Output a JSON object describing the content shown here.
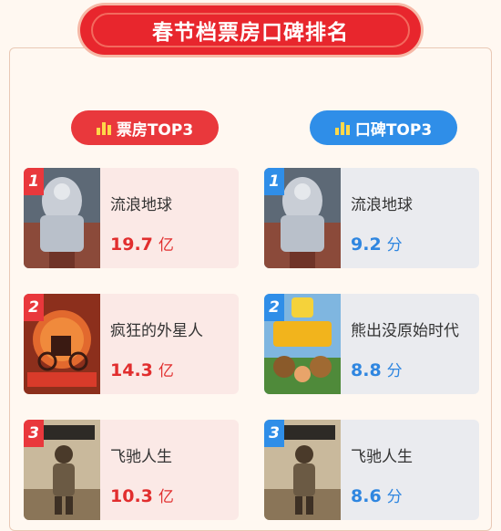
{
  "title": "春节档票房口碑排名",
  "box_office": {
    "label": "票房TOP3",
    "items": [
      {
        "rank": "1",
        "name": "流浪地球",
        "value": "19.7",
        "unit": "亿"
      },
      {
        "rank": "2",
        "name": "疯狂的外星人",
        "value": "14.3",
        "unit": "亿"
      },
      {
        "rank": "3",
        "name": "飞驰人生",
        "value": "10.3",
        "unit": "亿"
      }
    ]
  },
  "reputation": {
    "label": "口碑TOP3",
    "items": [
      {
        "rank": "1",
        "name": "流浪地球",
        "value": "9.2",
        "unit": "分"
      },
      {
        "rank": "2",
        "name": "熊出没原始时代",
        "value": "8.8",
        "unit": "分"
      },
      {
        "rank": "3",
        "name": "飞驰人生",
        "value": "8.6",
        "unit": "分"
      }
    ]
  },
  "colors": {
    "banner": "#e8262d",
    "box_office_accent": "#e9383c",
    "reputation_accent": "#2f8ee8"
  }
}
